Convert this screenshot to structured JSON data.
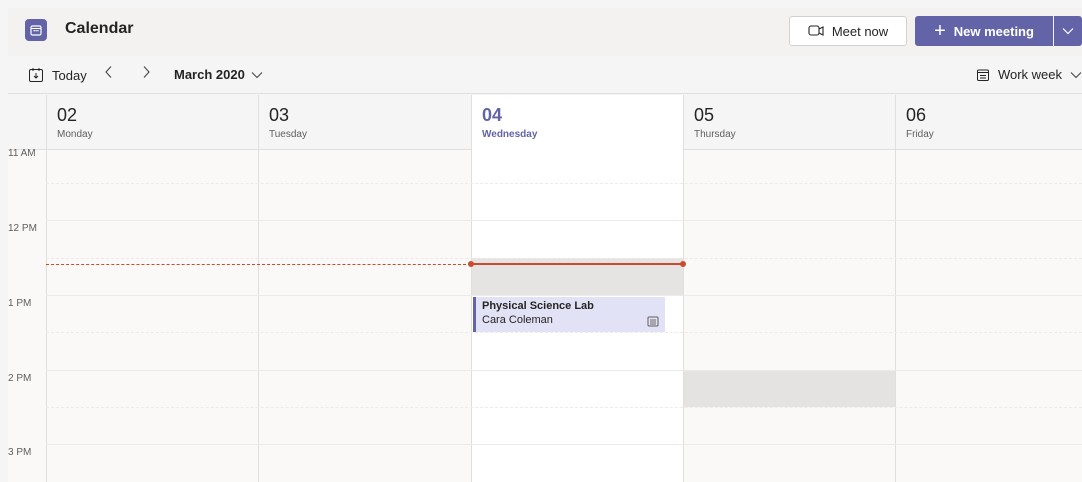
{
  "header": {
    "title": "Calendar",
    "meet_now_label": "Meet now",
    "new_meeting_label": "New meeting"
  },
  "toolbar": {
    "today_label": "Today",
    "month_label": "March 2020",
    "view_label": "Work week"
  },
  "days": [
    {
      "num": "02",
      "name": "Monday"
    },
    {
      "num": "03",
      "name": "Tuesday"
    },
    {
      "num": "04",
      "name": "Wednesday"
    },
    {
      "num": "05",
      "name": "Thursday"
    },
    {
      "num": "06",
      "name": "Friday"
    }
  ],
  "times": [
    "11 AM",
    "12 PM",
    "1 PM",
    "2 PM",
    "3 PM"
  ],
  "event": {
    "title": "Physical Science Lab",
    "organizer": "Cara Coleman"
  },
  "colors": {
    "brand": "#6264a7",
    "now_line": "#cc4a31",
    "event_bg": "#e2e2f6",
    "busy": "#e1dfdd"
  },
  "icons": {
    "calendar": "calendar-icon",
    "meet_now": "video-camera-icon",
    "event": "notes-icon"
  }
}
